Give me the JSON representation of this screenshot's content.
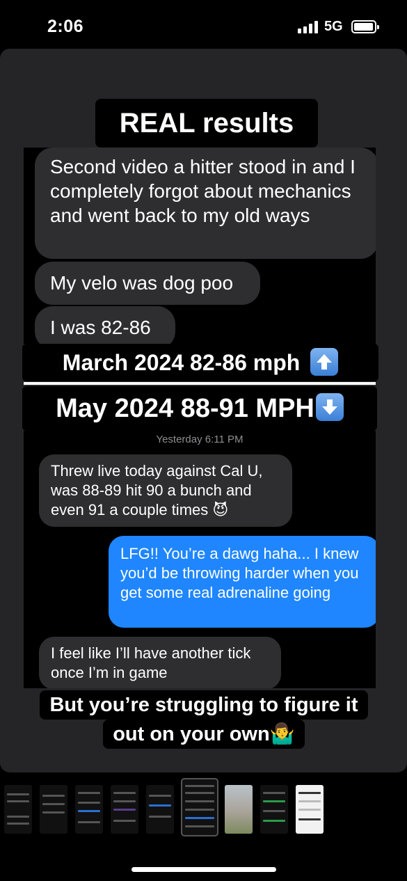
{
  "status_bar": {
    "time": "2:06",
    "network": "5G"
  },
  "captions": {
    "title": "REAL results",
    "march": "March 2024 82-86 mph",
    "may": "May 2024 88-91 MPH",
    "bottom_line1": "But you’re struggling to figure it",
    "bottom_line2": "out on your own🤷‍♂️"
  },
  "chat_before": {
    "messages": [
      "Second video a hitter stood in and I completely forgot about mechanics and went back to my old ways",
      "My velo was dog poo",
      "I was 82-86"
    ]
  },
  "chat_after": {
    "timestamp": "Yesterday 6:11 PM",
    "received_1": "Threw live today against Cal U, was 88-89 hit 90 a bunch and even 91 a couple times 😈",
    "sent_1": "LFG!! You’re a dawg haha... I knew you’d be throwing harder when you get some real adrenaline going",
    "received_2": "I feel like I’ll have another tick once I’m in game"
  },
  "icons": {
    "up": "up-arrow-emoji-icon",
    "down": "down-arrow-emoji-icon"
  },
  "colors": {
    "sent_bubble": "#1f86ff",
    "received_bubble": "#2e2e30",
    "card": "#252527"
  }
}
